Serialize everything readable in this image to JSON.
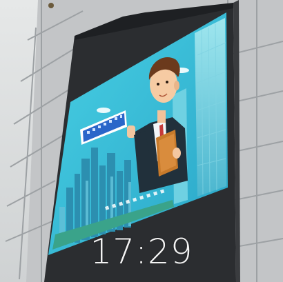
{
  "timestamp": "17:29",
  "colors": {
    "sky": "#d9dcdc",
    "facade": "#c4c6c8",
    "panel_grid": "#9a9ea1",
    "screen_frame": "#2c2e31",
    "screen_sky": "#3fc2d9",
    "suit": "#21303b",
    "shirt": "#f3f6f8",
    "tie": "#c63a3a",
    "folder": "#c77a2b",
    "badge": "#2a66c9"
  },
  "icons": [
    "led-billboard",
    "cartoon-businessman",
    "city-skyline",
    "speech-badge"
  ]
}
